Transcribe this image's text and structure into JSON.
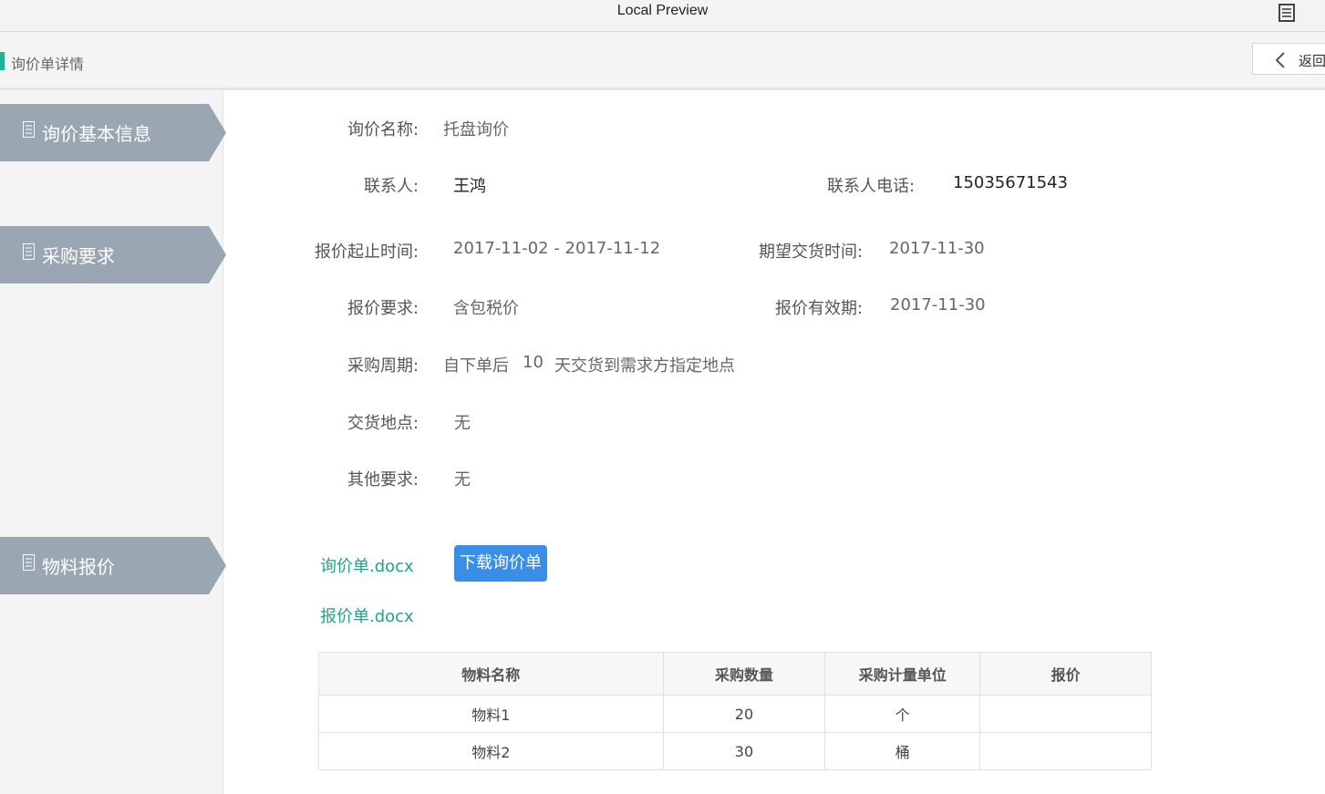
{
  "window": {
    "title": "Local Preview",
    "menu_icon": "list-icon"
  },
  "header": {
    "page_title": "询价单详情",
    "back_label": "返回",
    "accent_color": "#1fb394"
  },
  "sidebar": {
    "items": [
      {
        "label": "询价基本信息",
        "icon": "document-icon"
      },
      {
        "label": "采购要求",
        "icon": "document-icon"
      },
      {
        "label": "物料报价",
        "icon": "document-icon"
      }
    ]
  },
  "form": {
    "inquiry_name_label": "询价名称:",
    "inquiry_name": "托盘询价",
    "contact_label": "联系人:",
    "contact": "王鸿",
    "phone_label": "联系人电话:",
    "phone": "15035671543",
    "quote_period_label": "报价起止时间:",
    "quote_period": "2017-11-02 - 2017-11-12",
    "delivery_date_label": "期望交货时间:",
    "delivery_date": "2017-11-30",
    "quote_req_label": "报价要求:",
    "quote_req": "含包税价",
    "quote_valid_label": "报价有效期:",
    "quote_valid": "2017-11-30",
    "cycle_label": "采购周期:",
    "cycle_prefix": "自下单后",
    "cycle_days": "10",
    "cycle_suffix": "天交货到需求方指定地点",
    "place_label": "交货地点:",
    "place": "无",
    "other_label": "其他要求:",
    "other": "无"
  },
  "files": {
    "inquiry_file": "询价单.docx",
    "download_label": "下载询价单",
    "quote_file": "报价单.docx",
    "link_color": "#1ea48c",
    "button_color": "#3a8ee6"
  },
  "materials": {
    "headers": [
      "物料名称",
      "采购数量",
      "采购计量单位",
      "报价"
    ],
    "rows": [
      [
        "物料1",
        "20",
        "个",
        ""
      ],
      [
        "物料2",
        "30",
        "桶",
        ""
      ]
    ]
  }
}
